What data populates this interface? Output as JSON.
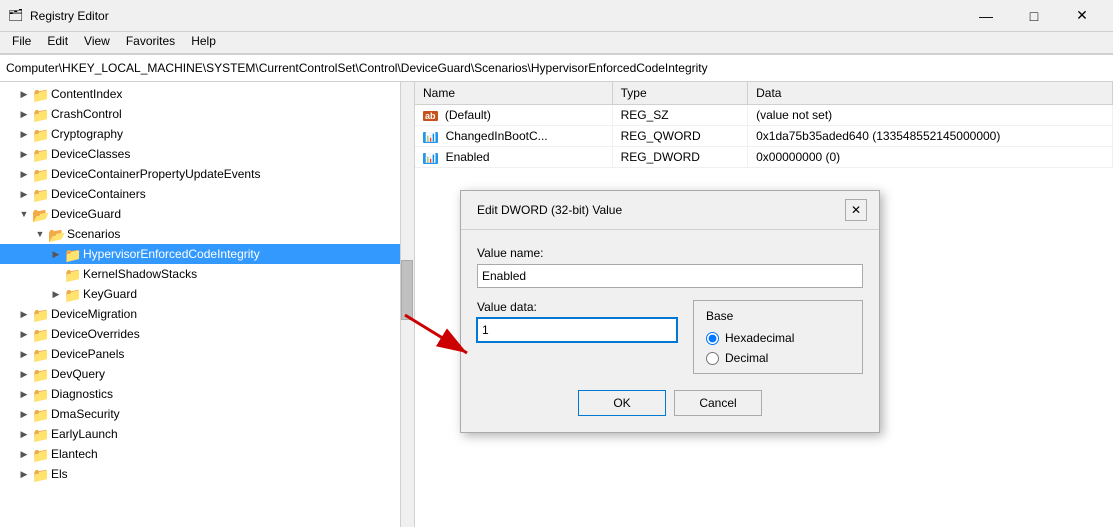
{
  "titlebar": {
    "icon": "🗂",
    "title": "Registry Editor",
    "minimize": "—",
    "maximize": "□",
    "close": "✕"
  },
  "menubar": {
    "items": [
      "File",
      "Edit",
      "View",
      "Favorites",
      "Help"
    ]
  },
  "addressbar": {
    "path": "Computer\\HKEY_LOCAL_MACHINE\\SYSTEM\\CurrentControlSet\\Control\\DeviceGuard\\Scenarios\\HypervisorEnforcedCodeIntegrity"
  },
  "tree": {
    "items": [
      {
        "id": "contentindex",
        "label": "ContentIndex",
        "indent": 1,
        "expanded": false,
        "selected": false
      },
      {
        "id": "crashcontrol",
        "label": "CrashControl",
        "indent": 1,
        "expanded": false,
        "selected": false
      },
      {
        "id": "cryptography",
        "label": "Cryptography",
        "indent": 1,
        "expanded": false,
        "selected": false
      },
      {
        "id": "deviceclasses",
        "label": "DeviceClasses",
        "indent": 1,
        "expanded": false,
        "selected": false
      },
      {
        "id": "devicecontainer-events",
        "label": "DeviceContainerPropertyUpdateEvents",
        "indent": 1,
        "expanded": false,
        "selected": false
      },
      {
        "id": "devicecontainers",
        "label": "DeviceContainers",
        "indent": 1,
        "expanded": false,
        "selected": false
      },
      {
        "id": "deviceguard",
        "label": "DeviceGuard",
        "indent": 1,
        "expanded": true,
        "selected": false
      },
      {
        "id": "scenarios",
        "label": "Scenarios",
        "indent": 2,
        "expanded": true,
        "selected": false
      },
      {
        "id": "hypervisor",
        "label": "HypervisorEnforcedCodeIntegrity",
        "indent": 3,
        "expanded": false,
        "selected": true
      },
      {
        "id": "kernelshadow",
        "label": "KernelShadowStacks",
        "indent": 3,
        "expanded": false,
        "selected": false
      },
      {
        "id": "keyguard",
        "label": "KeyGuard",
        "indent": 3,
        "expanded": false,
        "selected": false
      },
      {
        "id": "devicemigration",
        "label": "DeviceMigration",
        "indent": 1,
        "expanded": false,
        "selected": false
      },
      {
        "id": "deviceoverrides",
        "label": "DeviceOverrides",
        "indent": 1,
        "expanded": false,
        "selected": false
      },
      {
        "id": "devicepanels",
        "label": "DevicePanels",
        "indent": 1,
        "expanded": false,
        "selected": false
      },
      {
        "id": "devquery",
        "label": "DevQuery",
        "indent": 1,
        "expanded": false,
        "selected": false
      },
      {
        "id": "diagnostics",
        "label": "Diagnostics",
        "indent": 1,
        "expanded": false,
        "selected": false
      },
      {
        "id": "dmasecurity",
        "label": "DmaSecurity",
        "indent": 1,
        "expanded": false,
        "selected": false
      },
      {
        "id": "earlylaunch",
        "label": "EarlyLaunch",
        "indent": 1,
        "expanded": false,
        "selected": false
      },
      {
        "id": "elantech",
        "label": "Elantech",
        "indent": 1,
        "expanded": false,
        "selected": false
      },
      {
        "id": "els",
        "label": "Els",
        "indent": 1,
        "expanded": false,
        "selected": false
      }
    ]
  },
  "table": {
    "columns": [
      "Name",
      "Type",
      "Data"
    ],
    "rows": [
      {
        "icon": "ab",
        "name": "(Default)",
        "type": "REG_SZ",
        "data": "(value not set)"
      },
      {
        "icon": "bin",
        "name": "ChangedInBootC...",
        "type": "REG_QWORD",
        "data": "0x1da75b35aded640 (133548552145000000)"
      },
      {
        "icon": "bin",
        "name": "Enabled",
        "type": "REG_DWORD",
        "data": "0x00000000 (0)"
      }
    ]
  },
  "dialog": {
    "title": "Edit DWORD (32-bit) Value",
    "value_name_label": "Value name:",
    "value_name": "Enabled",
    "value_data_label": "Value data:",
    "value_data": "1",
    "base_label": "Base",
    "radio_hex": "Hexadecimal",
    "radio_dec": "Decimal",
    "ok_label": "OK",
    "cancel_label": "Cancel"
  }
}
